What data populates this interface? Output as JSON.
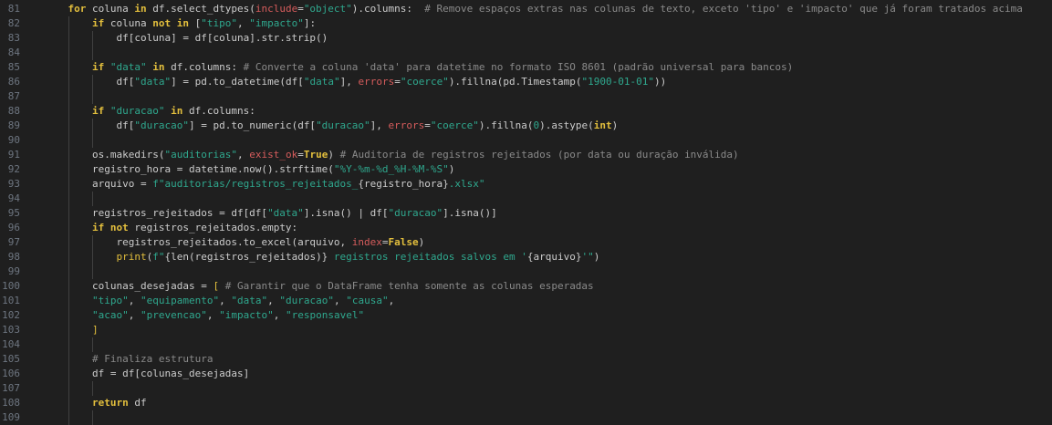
{
  "editor": {
    "language": "python",
    "colors": {
      "background": "#1f1f1f",
      "line_number": "#6e7681",
      "text": "#cccccc",
      "keyword": "#e3bf3d",
      "string": "#2fa88e",
      "comment": "#8a8a8a",
      "parameter": "#d65c5c"
    },
    "lines": [
      {
        "n": "81",
        "indent": 1,
        "tokens": [
          [
            "kw",
            "for"
          ],
          [
            "tx",
            " coluna "
          ],
          [
            "kw",
            "in"
          ],
          [
            "tx",
            " df.select_dtypes("
          ],
          [
            "pm",
            "include"
          ],
          [
            "tx",
            "="
          ],
          [
            "str",
            "\"object\""
          ],
          [
            "tx",
            ").columns:  "
          ],
          [
            "cm",
            "# Remove espaços extras nas colunas de texto, exceto 'tipo' e 'impacto' que já foram tratados acima"
          ]
        ]
      },
      {
        "n": "82",
        "indent": 2,
        "tokens": [
          [
            "kw",
            "if"
          ],
          [
            "tx",
            " coluna "
          ],
          [
            "kw",
            "not in"
          ],
          [
            "tx",
            " ["
          ],
          [
            "str",
            "\"tipo\""
          ],
          [
            "tx",
            ", "
          ],
          [
            "str",
            "\"impacto\""
          ],
          [
            "tx",
            "]:"
          ]
        ]
      },
      {
        "n": "83",
        "indent": 3,
        "tokens": [
          [
            "tx",
            "df[coluna] = df[coluna].str.strip()"
          ]
        ]
      },
      {
        "n": "84",
        "indent": 0,
        "tokens": []
      },
      {
        "n": "85",
        "indent": 2,
        "tokens": [
          [
            "kw",
            "if"
          ],
          [
            "tx",
            " "
          ],
          [
            "str",
            "\"data\""
          ],
          [
            "tx",
            " "
          ],
          [
            "kw",
            "in"
          ],
          [
            "tx",
            " df.columns: "
          ],
          [
            "cm",
            "# Converte a coluna 'data' para datetime no formato ISO 8601 (padrão universal para bancos)"
          ]
        ]
      },
      {
        "n": "86",
        "indent": 3,
        "tokens": [
          [
            "tx",
            "df["
          ],
          [
            "str",
            "\"data\""
          ],
          [
            "tx",
            "] = pd.to_datetime(df["
          ],
          [
            "str",
            "\"data\""
          ],
          [
            "tx",
            "], "
          ],
          [
            "pm",
            "errors"
          ],
          [
            "tx",
            "="
          ],
          [
            "str",
            "\"coerce\""
          ],
          [
            "tx",
            ").fillna(pd.Timestamp("
          ],
          [
            "str",
            "\"1900-01-01\""
          ],
          [
            "tx",
            "))"
          ]
        ]
      },
      {
        "n": "87",
        "indent": 0,
        "tokens": []
      },
      {
        "n": "88",
        "indent": 2,
        "tokens": [
          [
            "kw",
            "if"
          ],
          [
            "tx",
            " "
          ],
          [
            "str",
            "\"duracao\""
          ],
          [
            "tx",
            " "
          ],
          [
            "kw",
            "in"
          ],
          [
            "tx",
            " df.columns:"
          ]
        ]
      },
      {
        "n": "89",
        "indent": 3,
        "tokens": [
          [
            "tx",
            "df["
          ],
          [
            "str",
            "\"duracao\""
          ],
          [
            "tx",
            "] = pd.to_numeric(df["
          ],
          [
            "str",
            "\"duracao\""
          ],
          [
            "tx",
            "], "
          ],
          [
            "pm",
            "errors"
          ],
          [
            "tx",
            "="
          ],
          [
            "str",
            "\"coerce\""
          ],
          [
            "tx",
            ").fillna("
          ],
          [
            "num",
            "0"
          ],
          [
            "tx",
            ").astype("
          ],
          [
            "kw",
            "int"
          ],
          [
            "tx",
            ")"
          ]
        ]
      },
      {
        "n": "90",
        "indent": 0,
        "tokens": []
      },
      {
        "n": "91",
        "indent": 2,
        "tokens": [
          [
            "tx",
            "os.makedirs("
          ],
          [
            "str",
            "\"auditorias\""
          ],
          [
            "tx",
            ", "
          ],
          [
            "pm",
            "exist_ok"
          ],
          [
            "tx",
            "="
          ],
          [
            "kw",
            "True"
          ],
          [
            "tx",
            ") "
          ],
          [
            "cm",
            "# Auditoria de registros rejeitados (por data ou duração inválida)"
          ]
        ]
      },
      {
        "n": "92",
        "indent": 2,
        "tokens": [
          [
            "tx",
            "registro_hora = datetime.now().strftime("
          ],
          [
            "str",
            "\"%Y-%m-%d_%H-%M-%S\""
          ],
          [
            "tx",
            ")"
          ]
        ]
      },
      {
        "n": "93",
        "indent": 2,
        "tokens": [
          [
            "tx",
            "arquivo = "
          ],
          [
            "str",
            "f\"auditorias/registros_rejeitados_"
          ],
          [
            "tx",
            "{registro_hora}"
          ],
          [
            "str",
            ".xlsx\""
          ]
        ]
      },
      {
        "n": "94",
        "indent": 0,
        "tokens": []
      },
      {
        "n": "95",
        "indent": 2,
        "tokens": [
          [
            "tx",
            "registros_rejeitados = df[df["
          ],
          [
            "str",
            "\"data\""
          ],
          [
            "tx",
            "].isna() | df["
          ],
          [
            "str",
            "\"duracao\""
          ],
          [
            "tx",
            "].isna()]"
          ]
        ]
      },
      {
        "n": "96",
        "indent": 2,
        "tokens": [
          [
            "kw",
            "if not"
          ],
          [
            "tx",
            " registros_rejeitados.empty:"
          ]
        ]
      },
      {
        "n": "97",
        "indent": 3,
        "tokens": [
          [
            "tx",
            "registros_rejeitados.to_excel(arquivo, "
          ],
          [
            "pm",
            "index"
          ],
          [
            "tx",
            "="
          ],
          [
            "kw",
            "False"
          ],
          [
            "tx",
            ")"
          ]
        ]
      },
      {
        "n": "98",
        "indent": 3,
        "tokens": [
          [
            "kw2",
            "print"
          ],
          [
            "tx",
            "("
          ],
          [
            "str",
            "f\""
          ],
          [
            "tx",
            "{len(registros_rejeitados)}"
          ],
          [
            "str",
            " registros rejeitados salvos em '"
          ],
          [
            "tx",
            "{arquivo}"
          ],
          [
            "str",
            "'\""
          ],
          [
            "tx",
            ")"
          ]
        ]
      },
      {
        "n": "99",
        "indent": 0,
        "tokens": []
      },
      {
        "n": "100",
        "indent": 2,
        "tokens": [
          [
            "tx",
            "colunas_desejadas = "
          ],
          [
            "bk",
            "["
          ],
          [
            "tx",
            " "
          ],
          [
            "cm",
            "# Garantir que o DataFrame tenha somente as colunas esperadas"
          ]
        ]
      },
      {
        "n": "101",
        "indent": 2,
        "tokens": [
          [
            "str",
            "\"tipo\""
          ],
          [
            "tx",
            ", "
          ],
          [
            "str",
            "\"equipamento\""
          ],
          [
            "tx",
            ", "
          ],
          [
            "str",
            "\"data\""
          ],
          [
            "tx",
            ", "
          ],
          [
            "str",
            "\"duracao\""
          ],
          [
            "tx",
            ", "
          ],
          [
            "str",
            "\"causa\""
          ],
          [
            "tx",
            ","
          ]
        ]
      },
      {
        "n": "102",
        "indent": 2,
        "tokens": [
          [
            "str",
            "\"acao\""
          ],
          [
            "tx",
            ", "
          ],
          [
            "str",
            "\"prevencao\""
          ],
          [
            "tx",
            ", "
          ],
          [
            "str",
            "\"impacto\""
          ],
          [
            "tx",
            ", "
          ],
          [
            "str",
            "\"responsavel\""
          ]
        ]
      },
      {
        "n": "103",
        "indent": 2,
        "tokens": [
          [
            "bk",
            "]"
          ]
        ]
      },
      {
        "n": "104",
        "indent": 0,
        "tokens": []
      },
      {
        "n": "105",
        "indent": 2,
        "tokens": [
          [
            "cm",
            "# Finaliza estrutura"
          ]
        ]
      },
      {
        "n": "106",
        "indent": 2,
        "tokens": [
          [
            "tx",
            "df = df[colunas_desejadas]"
          ]
        ]
      },
      {
        "n": "107",
        "indent": 0,
        "tokens": []
      },
      {
        "n": "108",
        "indent": 2,
        "tokens": [
          [
            "kw",
            "return"
          ],
          [
            "tx",
            " df"
          ]
        ]
      },
      {
        "n": "109",
        "indent": 0,
        "tokens": []
      }
    ]
  }
}
